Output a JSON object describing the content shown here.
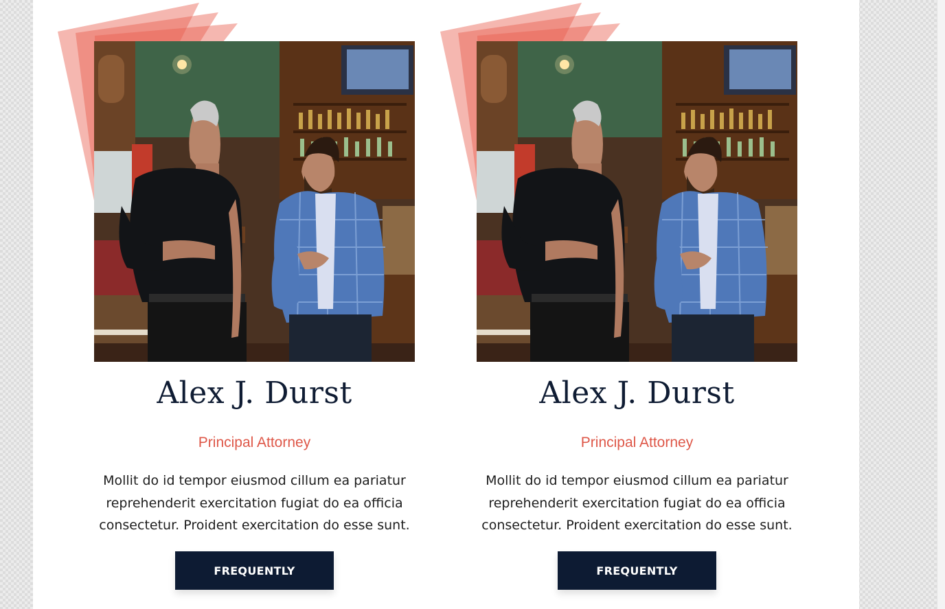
{
  "cards": [
    {
      "name": "Alex J. Durst",
      "role": "Principal Attorney",
      "bio": "Mollit do id tempor eiusmod cillum ea pariatur reprehenderit exercitation fugiat do ea officia consectetur. Proident exercitation do esse sunt.",
      "button_label": "FREQUENTLY"
    },
    {
      "name": "Alex J. Durst",
      "role": "Principal Attorney",
      "bio": "Mollit do id tempor eiusmod cillum ea pariatur reprehenderit exercitation fugiat do ea officia consectetur. Proident exercitation do esse sunt.",
      "button_label": "FREQUENTLY"
    }
  ],
  "colors": {
    "accent": "#de5748",
    "navy": "#0d1b33"
  }
}
